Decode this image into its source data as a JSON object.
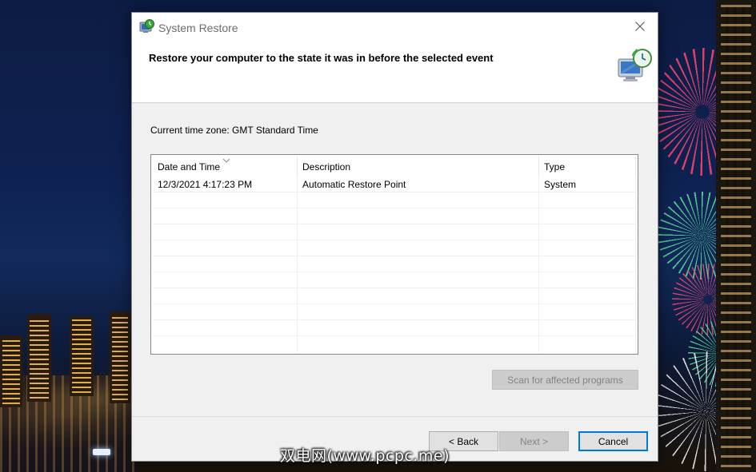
{
  "window": {
    "title": "System Restore",
    "icon": "system-restore-icon",
    "close_icon": "close-icon"
  },
  "header": {
    "heading": "Restore your computer to the state it was in before the selected event",
    "icon": "restore-monitor-clock-icon"
  },
  "timezone_text": "Current time zone: GMT Standard Time",
  "table": {
    "columns": [
      "Date and Time",
      "Description",
      "Type"
    ],
    "sorted_column": "Date and Time",
    "rows": [
      [
        "12/3/2021 4:17:23 PM",
        "Automatic Restore Point",
        "System"
      ]
    ]
  },
  "buttons": {
    "scan": "Scan for affected programs",
    "back": "< Back",
    "next": "Next >",
    "cancel": "Cancel"
  },
  "watermark": "双电网(www.pcpc.me)",
  "colors": {
    "dialog_bg": "#f0f0f0",
    "header_bg": "#ffffff",
    "accent": "#0078d7"
  }
}
